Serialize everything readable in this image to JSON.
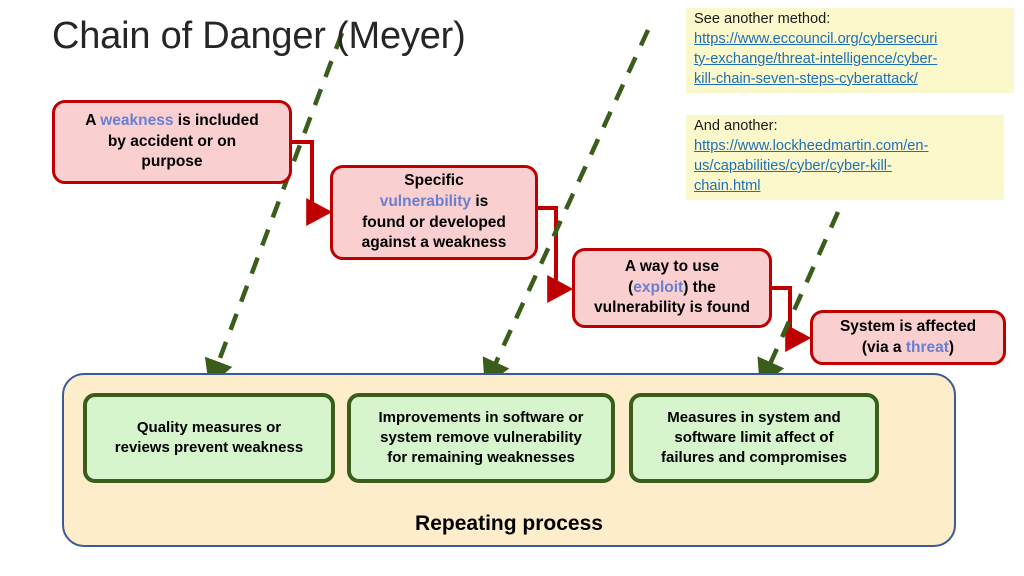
{
  "slide": {
    "title": "Chain of Danger (Meyer)",
    "background_color": "#ffffff"
  },
  "colors": {
    "danger_border": "#c00000",
    "danger_fill": "#f9cfcf",
    "highlight_term": "#6b7fd1",
    "mitigation_border": "#3a5d1c",
    "mitigation_fill": "#d6f5cc",
    "container_fill": "#fdedcb",
    "container_border": "#3c5a9a",
    "note_fill": "#fbf8cc",
    "link_color": "#1f6fb5",
    "dashed_arrow": "#3a5d1c"
  },
  "chain": {
    "steps": [
      {
        "id": "weakness",
        "line1_before": "A ",
        "highlight": "weakness",
        "line1_after": " is included",
        "line2": "by accident or on",
        "line3": "purpose"
      },
      {
        "id": "vulnerability",
        "line1": "Specific",
        "highlight": "vulnerability",
        "line2_after": " is",
        "line3": "found or developed",
        "line4": "against a weakness"
      },
      {
        "id": "exploit",
        "line1": "A way to use",
        "line2_before": "(",
        "highlight": "exploit",
        "line2_after": ") the",
        "line3": "vulnerability is found"
      },
      {
        "id": "threat",
        "line1": "System is affected",
        "line2_before": "(via a ",
        "highlight": "threat",
        "line2_after": ")"
      }
    ]
  },
  "mitigation": {
    "label": "Repeating process",
    "boxes": [
      {
        "id": "quality",
        "line1": "Quality measures or",
        "line2": "reviews prevent weakness"
      },
      {
        "id": "improvements",
        "line1": "Improvements in software or",
        "line2": "system remove vulnerability",
        "line3": "for remaining weaknesses"
      },
      {
        "id": "measures",
        "line1": "Measures in system and",
        "line2": "software limit affect of",
        "line3": "failures and compromises"
      }
    ]
  },
  "notes": [
    {
      "id": "note-one",
      "lead": "See another method:",
      "link_lines": [
        "https://www.eccouncil.org/cybersecuri",
        "ty-exchange/threat-intelligence/cyber-",
        "kill-chain-seven-steps-cyberattack/"
      ]
    },
    {
      "id": "note-two",
      "lead": "And another:",
      "link_lines": [
        "https://www.lockheedmartin.com/en-",
        "us/capabilities/cyber/cyber-kill-",
        "chain.html"
      ]
    }
  ]
}
